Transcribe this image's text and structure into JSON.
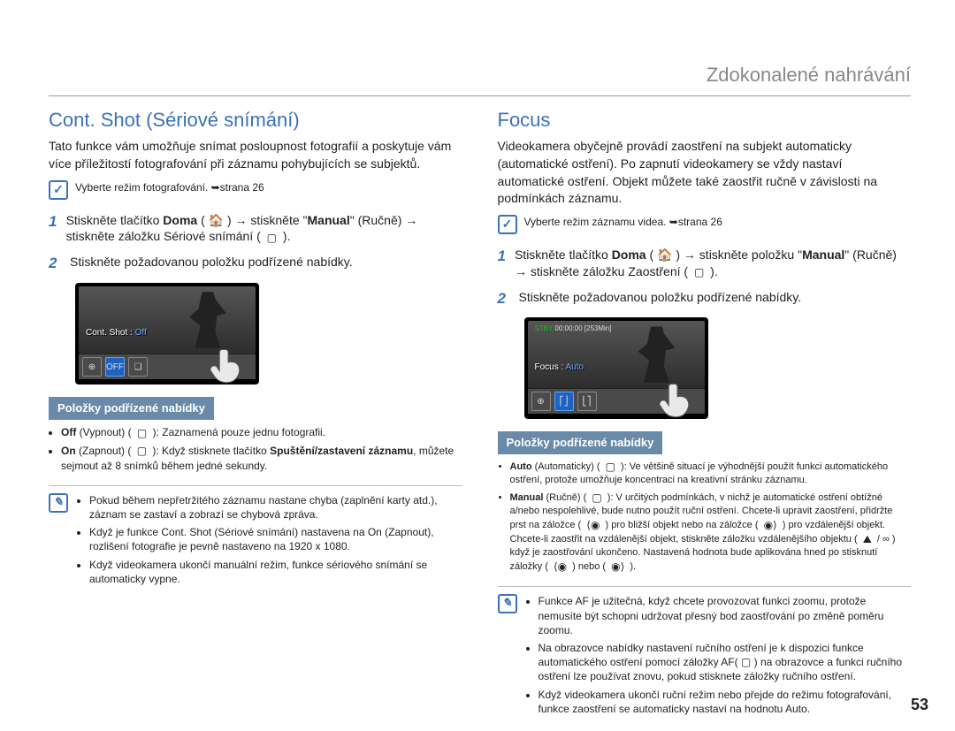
{
  "chapter": "Zdokonalené nahrávání",
  "page_number": "53",
  "left": {
    "title": "Cont. Shot (Sériové snímání)",
    "intro": "Tato funkce vám umožňuje snímat posloupnost fotografií a poskytuje vám více příležitostí fotografování při záznamu pohybujících se subjektů.",
    "precheck": "Vyberte režim fotografování. ➥strana 26",
    "step1_a": "Stiskněte tlačítko ",
    "step1_b_bold": "Doma",
    "step1_c": " ( 🏠 ) → stiskněte \"",
    "step1_d_bold": "Manual",
    "step1_e": "\" (Ručně) → stiskněte záložku Sériové snímání ( ",
    "step1_f": " ).",
    "step2": "Stiskněte požadovanou položku podřízené nabídky.",
    "shot_label": "Cont. Shot : ",
    "shot_value": "Off",
    "sub_header": "Položky podřízené nabídky",
    "sub1_a_bold": "Off",
    "sub1_b": " (Vypnout) ( ",
    "sub1_c": " ): Zaznamená pouze jednu fotografii.",
    "sub2_a_bold": "On",
    "sub2_b": " (Zapnout) ( ",
    "sub2_c": " ): Když stisknete tlačítko ",
    "sub2_d_bold": "Spuštění/zastavení záznamu",
    "sub2_e": ", můžete sejmout až 8 snímků během jedné sekundy.",
    "note1": "Pokud během nepřetržitého záznamu nastane chyba (zaplnění karty atd.), záznam se zastaví a zobrazí se chybová zpráva.",
    "note2": "Když je funkce Cont. Shot (Sériové snímání) nastavena na On (Zapnout), rozlišení fotografie je pevně nastaveno na 1920 x 1080.",
    "note3": "Když videokamera ukončí manuální režim, funkce sériového snímání se automaticky vypne."
  },
  "right": {
    "title": "Focus",
    "intro": "Videokamera obyčejně provádí zaostření na subjekt automaticky (automatické ostření). Po zapnutí videokamery se vždy nastaví automatické ostření. Objekt můžete také zaostřit ručně v závislosti na podmínkách záznamu.",
    "precheck": "Vyberte režim záznamu videa. ➥strana 26",
    "step1_a": "Stiskněte tlačítko ",
    "step1_b_bold": "Doma",
    "step1_c": " ( 🏠 ) → stiskněte položku \"",
    "step1_d_bold": "Manual",
    "step1_e": "\" (Ručně) → stiskněte záložku Zaostření ( ",
    "step1_f": " ).",
    "step2": "Stiskněte požadovanou položku podřízené nabídky.",
    "shot_stby": "STBY",
    "shot_time": "00:00:00 [253Min]",
    "shot_label": "Focus : ",
    "shot_value": "Auto",
    "sub_header": "Položky podřízené nabídky",
    "sub1_a_bold": "Auto",
    "sub1_b": " (Automaticky) ( ",
    "sub1_c": " ): Ve většině situací je výhodnější použít funkci automatického ostření, protože umožňuje koncentraci na kreativní stránku záznamu.",
    "sub2_a_bold": "Manual",
    "sub2_b": " (Ručně) ( ",
    "sub2_c": " ): V určitých podmínkách, v nichž je automatické ostření obtížné a/nebo nespolehlivé, bude nutno použít ruční ostření. Chcete-li upravit zaostření, přidržte prst na záložce ( ",
    "sub2_d": " ) pro bližší objekt nebo na záložce ( ",
    "sub2_e": " ) pro vzdálenější objekt. Chcete-li zaostřit na vzdálenější objekt, stiskněte záložku vzdálenějšího objektu ( ",
    "sub2_f": " / ∞ ) když je zaostřování ukončeno. Nastavená hodnota bude aplikována hned po stisknutí záložky ( ",
    "sub2_g": " ) nebo ( ",
    "sub2_h": " ).",
    "note1": "Funkce AF je užitečná, když chcete provozovat funkci zoomu, protože nemusíte být schopni udržovat přesný bod zaostřování po změně poměru zoomu.",
    "note2": "Na obrazovce nabídky nastavení ručního ostření je k dispozici funkce automatického ostření pomocí záložky AF( ▢ ) na obrazovce a funkci ručního ostření lze používat znovu, pokud stisknete záložky ručního ostření.",
    "note3": "Když videokamera ukončí ruční režim nebo přejde do režimu fotografování, funkce zaostření se automaticky nastaví na hodnotu Auto."
  }
}
